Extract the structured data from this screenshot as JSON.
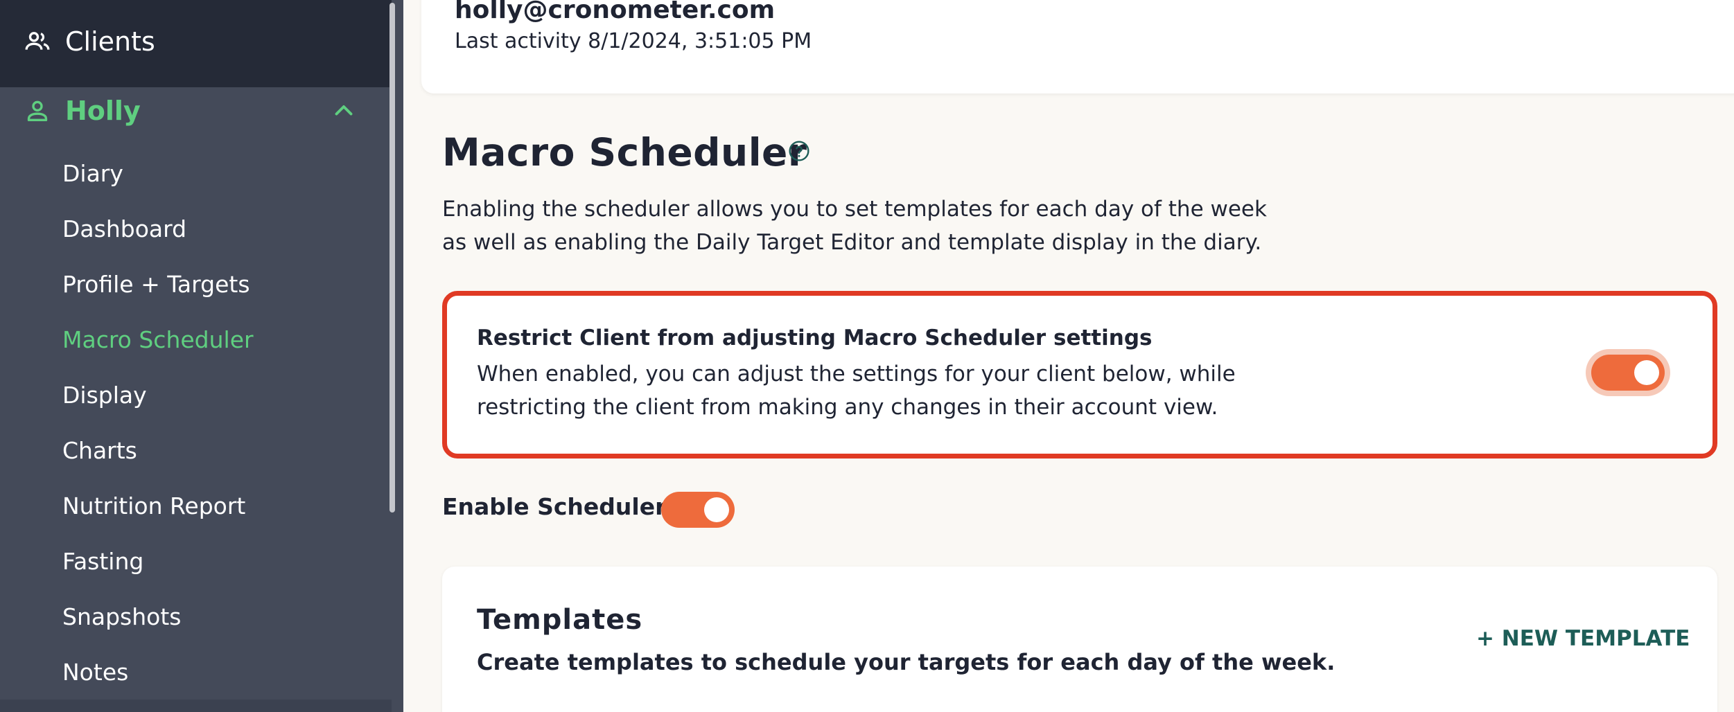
{
  "sidebar": {
    "clients_label": "Clients",
    "client_name": "Holly",
    "items": [
      {
        "label": "Diary"
      },
      {
        "label": "Dashboard"
      },
      {
        "label": "Profile + Targets"
      },
      {
        "label": "Macro Scheduler"
      },
      {
        "label": "Display"
      },
      {
        "label": "Charts"
      },
      {
        "label": "Nutrition Report"
      },
      {
        "label": "Fasting"
      },
      {
        "label": "Snapshots"
      },
      {
        "label": "Notes"
      }
    ],
    "active_item": "Macro Scheduler"
  },
  "client": {
    "email": "holly@cronometer.com",
    "last_activity": "Last activity 8/1/2024, 3:51:05 PM"
  },
  "main": {
    "title": "Macro Scheduler",
    "description": "Enabling the scheduler allows you to set templates for each day of the week as well as enabling the Daily Target Editor and template display in the diary.",
    "restrict": {
      "title": "Restrict Client from adjusting Macro Scheduler settings",
      "description": "When enabled, you can adjust the settings for your client below, while restricting the client from making any changes in their account view.",
      "enabled": true
    },
    "enable_scheduler": {
      "label": "Enable Scheduler",
      "enabled": true
    },
    "templates": {
      "title": "Templates",
      "description": "Create templates to schedule your targets for each day of the week.",
      "new_button": "+ NEW TEMPLATE"
    }
  },
  "colors": {
    "sidebar_bg": "#444a59",
    "sidebar_top_bg": "#252a37",
    "active_green": "#5fcf80",
    "toggle_orange": "#ee6b3c",
    "highlight_red": "#e03a24",
    "link_teal": "#1d5d57"
  },
  "icons": {
    "clients": "people-icon",
    "client": "person-icon",
    "collapse": "chevron-up-icon",
    "help": "question-circle-icon"
  }
}
